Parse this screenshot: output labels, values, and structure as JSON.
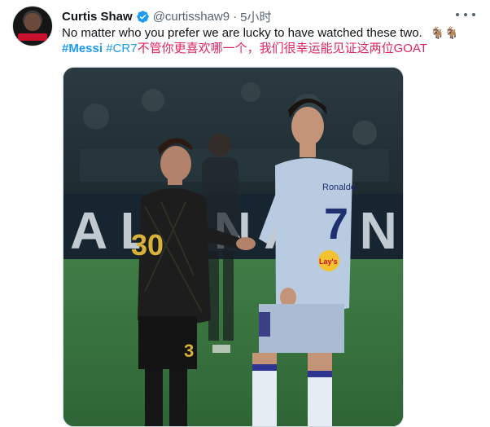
{
  "tweet": {
    "author": {
      "display_name": "Curtis Shaw",
      "handle": "@curtisshaw9",
      "separator": "·",
      "time": "5小时",
      "avatar_icon": "profile-photo",
      "verified_icon": "verified-badge-icon"
    },
    "text_line1": "No matter who you prefer we are lucky to have watched these two.",
    "emoji": "🐐🐐",
    "hashtag_messi": "#Messi",
    "hashtag_cr7": "#CR7",
    "text_cn": "不管你更喜欢哪一个，我们很幸运能见证这两位GOAT",
    "more_icon": "more-options-icon",
    "media": {
      "left_jersey_number": "30",
      "right_jersey_number": "7",
      "right_jersey_sponsor": "Lay's",
      "right_jersey_name": "Ronaldo",
      "background_sign": "A L A N   A L N"
    }
  },
  "colors": {
    "link": "#1d9bf0",
    "chinese_text": "#e0245e",
    "secondary_text": "#536471",
    "verified": "#1d9bf0"
  }
}
